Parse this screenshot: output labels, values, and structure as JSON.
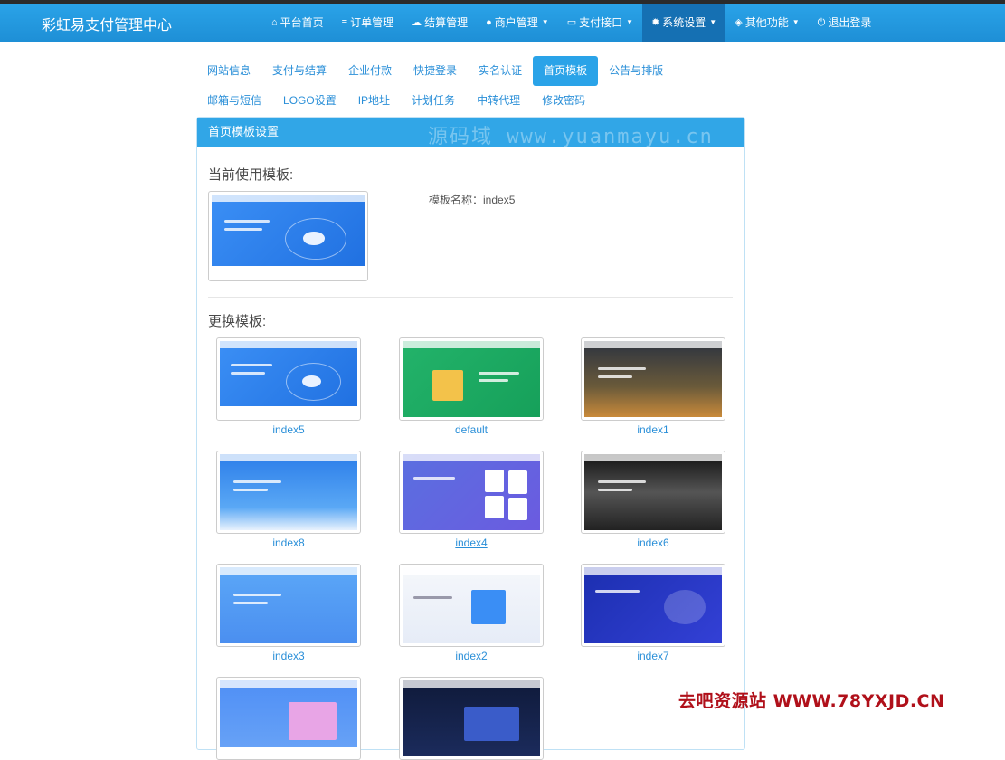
{
  "brand": "彩虹易支付管理中心",
  "nav": [
    {
      "icon": "home-icon",
      "glyph": "⌂",
      "label": "平台首页",
      "caret": false,
      "active": false
    },
    {
      "icon": "list-icon",
      "glyph": "≡",
      "label": "订单管理",
      "caret": false,
      "active": false
    },
    {
      "icon": "cloud-icon",
      "glyph": "☁",
      "label": "结算管理",
      "caret": false,
      "active": false
    },
    {
      "icon": "user-icon",
      "glyph": "●",
      "label": "商户管理",
      "caret": true,
      "active": false
    },
    {
      "icon": "card-icon",
      "glyph": "▭",
      "label": "支付接口",
      "caret": true,
      "active": false
    },
    {
      "icon": "gear-icon",
      "glyph": "✹",
      "label": "系统设置",
      "caret": true,
      "active": true
    },
    {
      "icon": "cube-icon",
      "glyph": "◈",
      "label": "其他功能",
      "caret": true,
      "active": false
    },
    {
      "icon": "power-icon",
      "glyph": "⏻",
      "label": "退出登录",
      "caret": false,
      "active": false
    }
  ],
  "tabs_row1": [
    "网站信息",
    "支付与结算",
    "企业付款",
    "快捷登录",
    "实名认证",
    "首页模板",
    "公告与排版"
  ],
  "tabs_row2": [
    "邮箱与短信",
    "LOGO设置",
    "IP地址",
    "计划任务",
    "中转代理",
    "修改密码"
  ],
  "active_tab": "首页模板",
  "panel": {
    "title": "首页模板设置",
    "watermark": "源码域 www.yuanmayu.cn",
    "current_label": "当前使用模板:",
    "template_name_label": "模板名称：index5",
    "change_label": "更换模板:"
  },
  "templates": [
    {
      "name": "index5",
      "theme": "blue-orbit"
    },
    {
      "name": "default",
      "theme": "green-cart"
    },
    {
      "name": "index1",
      "theme": "night-city"
    },
    {
      "name": "index8",
      "theme": "blue-wave"
    },
    {
      "name": "index4",
      "theme": "purple-cards"
    },
    {
      "name": "index6",
      "theme": "bw-city"
    },
    {
      "name": "index3",
      "theme": "light-blue"
    },
    {
      "name": "index2",
      "theme": "iso-white"
    },
    {
      "name": "index7",
      "theme": "deep-blue"
    },
    {
      "name": "",
      "theme": "laptop"
    },
    {
      "name": "",
      "theme": "dark-navy"
    }
  ],
  "bottom_watermark": "去吧资源站 WWW.78YXJD.CN",
  "colors": {
    "header": "#2aa3e8",
    "active_nav": "#1570b3",
    "link": "#2a8fd8",
    "watermark_red": "#b0101a"
  }
}
